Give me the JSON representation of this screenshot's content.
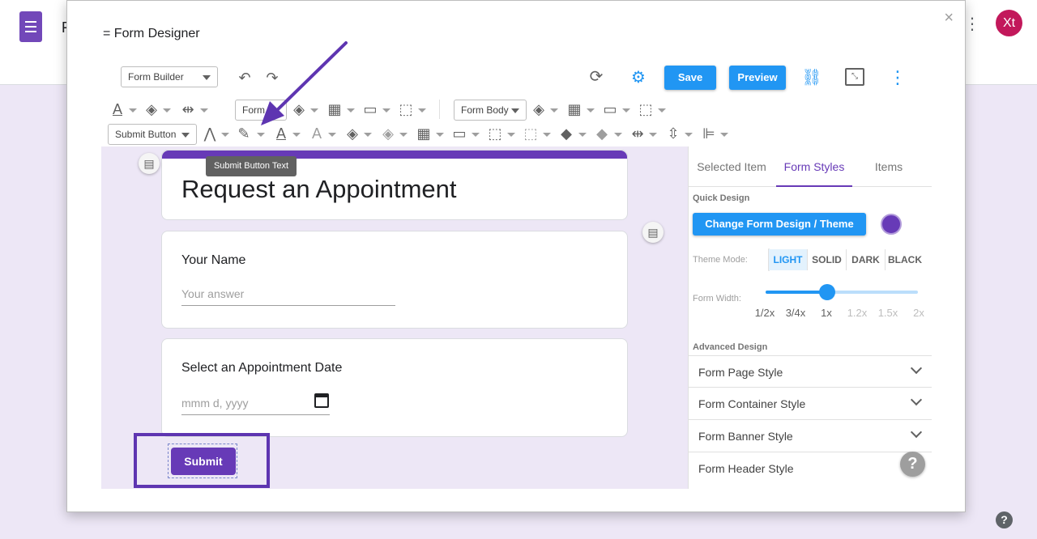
{
  "bg": {
    "title_partial": "F",
    "avatar_initials": "Xt",
    "help": "?"
  },
  "dialog": {
    "title": "= Form Designer",
    "close": "×"
  },
  "toolbar": {
    "mode_select": "Form Builder",
    "save_label": "Save",
    "preview_label": "Preview",
    "row1_field_select": "Form",
    "row1_body_select": "Form Body",
    "row2_field_select": "Submit Button",
    "tooltip": "Submit Button Text",
    "colors": {
      "accent": "#2196f3",
      "brand": "#673ab7",
      "annotation": "#5e35b1"
    }
  },
  "form": {
    "title": "Request an Appointment",
    "questions": [
      {
        "label": "Your Name",
        "placeholder": "Your answer"
      },
      {
        "label": "Select an Appointment Date",
        "placeholder": "mmm d, yyyy"
      }
    ],
    "submit_label": "Submit"
  },
  "panel": {
    "tabs": [
      "Selected Item",
      "Form Styles",
      "Items"
    ],
    "active_tab": "Form Styles",
    "quick_design_label": "Quick Design",
    "theme_button": "Change Form Design / Theme",
    "theme_mode_label": "Theme Mode:",
    "theme_modes": [
      "LIGHT",
      "SOLID",
      "DARK",
      "BLACK"
    ],
    "active_mode": "LIGHT",
    "form_width_label": "Form Width:",
    "width_ticks": [
      "1/2x",
      "3/4x",
      "1x",
      "1.2x",
      "1.5x",
      "2x"
    ],
    "width_selected": "1x",
    "advanced_label": "Advanced Design",
    "sections": [
      "Form Page Style",
      "Form Container Style",
      "Form Banner Style",
      "Form Header Style"
    ],
    "help": "?"
  }
}
